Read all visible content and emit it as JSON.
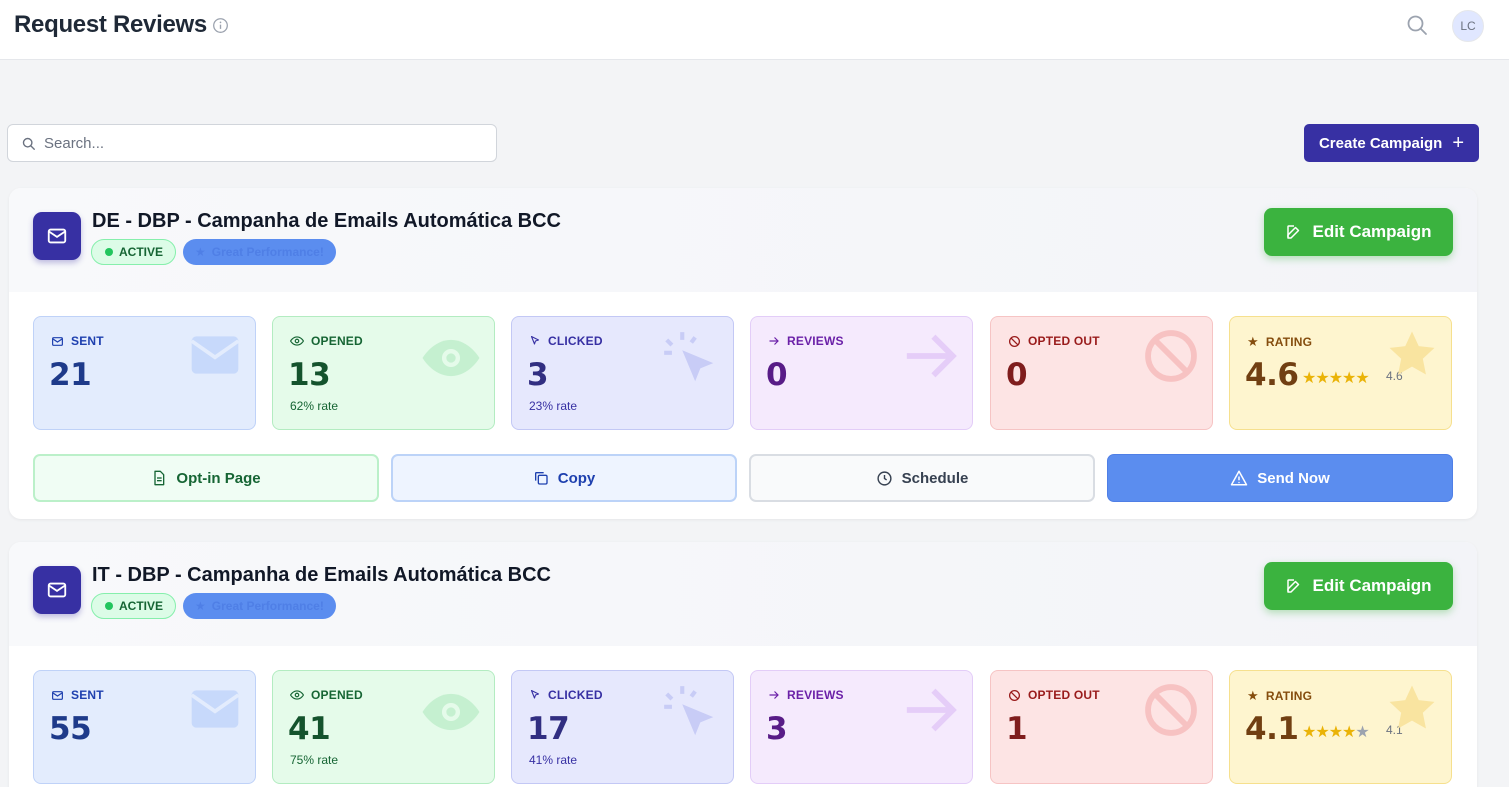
{
  "header": {
    "title": "Request Reviews",
    "avatar_initials": "LC"
  },
  "toolbar": {
    "search_placeholder": "Search...",
    "create_label": "Create Campaign"
  },
  "campaigns": [
    {
      "title": "DE - DBP - Campanha de Emails Automática BCC",
      "status": "ACTIVE",
      "performance_badge": "Great Performance!",
      "edit_label": "Edit Campaign",
      "stats": {
        "sent": {
          "label": "SENT",
          "value": "21"
        },
        "opened": {
          "label": "OPENED",
          "value": "13",
          "rate": "62% rate"
        },
        "clicked": {
          "label": "CLICKED",
          "value": "3",
          "rate": "23% rate"
        },
        "reviews": {
          "label": "REVIEWS",
          "value": "0"
        },
        "opted_out": {
          "label": "OPTED OUT",
          "value": "0"
        },
        "rating": {
          "label": "RATING",
          "value": "4.6",
          "small": "4.6",
          "stars_filled": 5
        }
      },
      "actions": {
        "optin": "Opt-in Page",
        "copy": "Copy",
        "schedule": "Schedule",
        "send": "Send Now"
      }
    },
    {
      "title": "IT - DBP - Campanha de Emails Automática BCC",
      "status": "ACTIVE",
      "performance_badge": "Great Performance!",
      "edit_label": "Edit Campaign",
      "stats": {
        "sent": {
          "label": "SENT",
          "value": "55"
        },
        "opened": {
          "label": "OPENED",
          "value": "41",
          "rate": "75% rate"
        },
        "clicked": {
          "label": "CLICKED",
          "value": "17",
          "rate": "41% rate"
        },
        "reviews": {
          "label": "REVIEWS",
          "value": "3"
        },
        "opted_out": {
          "label": "OPTED OUT",
          "value": "1"
        },
        "rating": {
          "label": "RATING",
          "value": "4.1",
          "small": "4.1",
          "stars_filled": 4
        }
      }
    }
  ],
  "colors": {
    "primary": "#3730a3",
    "success": "#3bb33f",
    "send": "#5b8def",
    "page_bg": "#f3f4f6"
  }
}
